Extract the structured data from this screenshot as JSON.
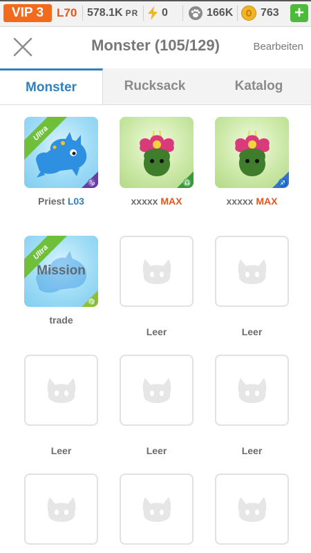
{
  "status": {
    "vip": "VIP 3",
    "level": "L70",
    "power": "578.1K",
    "power_unit": "PR",
    "energy": "0",
    "food": "166K",
    "gold": "763",
    "plus": "+"
  },
  "header": {
    "title": "Monster (105/129)",
    "edit": "Bearbeiten"
  },
  "tabs": [
    "Monster",
    "Rucksack",
    "Katalog"
  ],
  "colors": {
    "accent": "#2f7fc1",
    "vip": "#f26a1b",
    "max": "#e4571c",
    "plus": "#4dbb3a"
  },
  "monsters": [
    {
      "ribbon": "Ultra",
      "name": "Priest",
      "level": "L03",
      "zodiac": "♑"
    },
    {
      "name": "xxxxx",
      "level": "MAX",
      "zodiac": "♎"
    },
    {
      "name": "xxxxx",
      "level": "MAX",
      "zodiac": "♐"
    },
    {
      "ribbon": "Ultra",
      "overlay": "Mission",
      "name": "trade",
      "zodiac": "♍"
    }
  ],
  "empty_label": "Leer"
}
